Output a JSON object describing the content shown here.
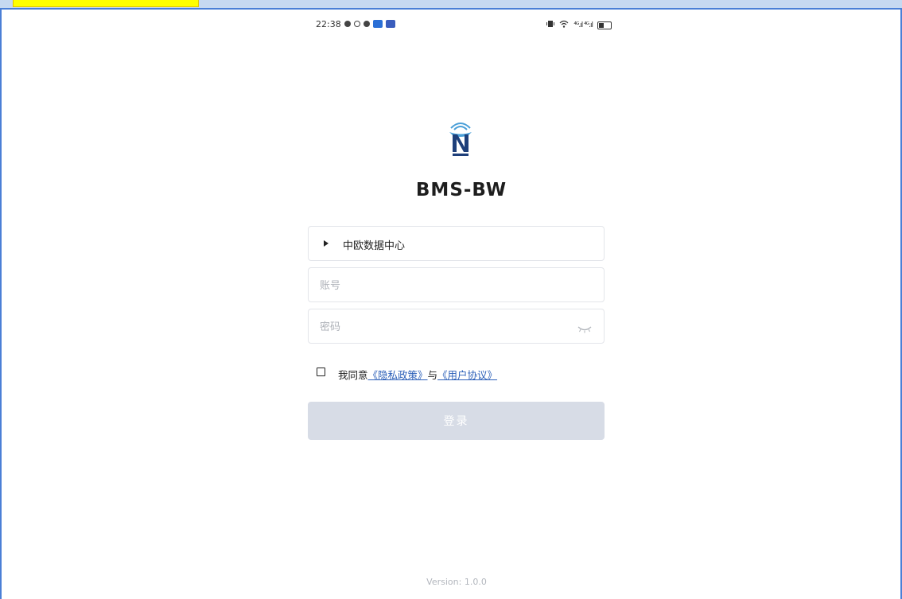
{
  "highlight_tag": "",
  "status_bar": {
    "time": "22:38",
    "signal_text": "⁴ᴳ.ıl ⁴ᴳ.ıl",
    "icons_left": [
      "notification-dot-icon",
      "search-status-icon",
      "sync-dot-icon",
      "blue-app-icon",
      "navy-app-icon"
    ],
    "icons_right": [
      "vibrate-icon",
      "wifi-icon",
      "signal-icon",
      "signal-icon",
      "battery-icon"
    ]
  },
  "app": {
    "logo_icon": "nexus-logo-icon",
    "title": "BMS-BW"
  },
  "form": {
    "server_label": "中欧数据中心",
    "account_placeholder": "账号",
    "password_placeholder": "密码",
    "password_toggle_icon": "eye-closed-icon",
    "agree_prefix": "我同意",
    "privacy_link": "《隐私政策》",
    "agree_middle": "与",
    "terms_link": "《用户协议》",
    "login_label": "登录"
  },
  "version": "Version: 1.0.0",
  "colors": {
    "accent_link": "#2b5fb8",
    "login_disabled": "#d7dce6",
    "frame_border": "#4a7fd6",
    "tag_yellow": "#ffff00"
  }
}
